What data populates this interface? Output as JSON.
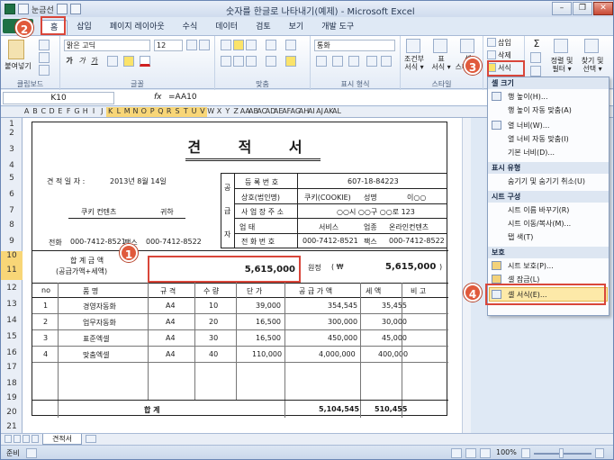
{
  "window": {
    "title": "숫자를 한글로 나타내기(예제) - Microsoft Excel",
    "qat_label": "눈금선"
  },
  "tabs": [
    "홈",
    "삽입",
    "페이지 레이아웃",
    "수식",
    "데이터",
    "검토",
    "보기",
    "개발 도구"
  ],
  "ribbon": {
    "clipboard": {
      "paste": "붙여넣기",
      "label": "클립보드"
    },
    "font": {
      "name": "맑은 고딕",
      "size": "12",
      "bold": "가",
      "italic": "가",
      "underline": "가",
      "label": "글꼴"
    },
    "alignment": {
      "label": "맞춤"
    },
    "number": {
      "format": "통화",
      "label": "표시 형식"
    },
    "style": {
      "cond": "조건부",
      "cond2": "서식 ▾",
      "table": "표",
      "table2": "서식 ▾",
      "cell": "셀",
      "cell2": "스타일 ▾",
      "label": "스타일"
    },
    "cells": {
      "insert": "삽입",
      "delete": "삭제",
      "format": "서식"
    },
    "editing": {
      "sort": "정렬 및",
      "sort2": "필터 ▾",
      "find": "찾기 및",
      "find2": "선택 ▾"
    }
  },
  "formula_bar": {
    "name_box": "K10",
    "fx": "fx",
    "content": "=AA10"
  },
  "columns": [
    "A",
    "B",
    "C",
    "D",
    "E",
    "F",
    "G",
    "H",
    "I",
    "J",
    "K",
    "L",
    "M",
    "N",
    "O",
    "P",
    "Q",
    "R",
    "S",
    "T",
    "U",
    "V",
    "W",
    "X",
    "Y",
    "Z",
    "AA",
    "AB",
    "AC",
    "AD",
    "AE",
    "AF",
    "AG",
    "AH",
    "AI",
    "AJ",
    "AK",
    "AL"
  ],
  "rows": [
    "1",
    "2",
    "3",
    "4",
    "5",
    "6",
    "7",
    "8",
    "9",
    "10",
    "11",
    "12",
    "13",
    "14",
    "15",
    "16",
    "17",
    "18",
    "19",
    "20",
    "21"
  ],
  "doc": {
    "title": "견 적 서",
    "date_label": "견 적 일 자 :",
    "date_value": "2013년 8월 14일",
    "client": "쿠키 컨텐츠",
    "honorific": "귀하",
    "phone_label": "전화",
    "phone": "000-7412-8521",
    "fax_label": "팩스",
    "fax": "000-7412-8522",
    "supplier_vertical": [
      "공",
      "급",
      "자"
    ],
    "supplier": {
      "reg_label": "등 록 번 호",
      "reg_value": "607-18-84223",
      "company_label": "상호(법인명)",
      "company_value": "쿠키(COOKIE)",
      "name_label": "성명",
      "name_value": "이○○",
      "addr_label": "사 업 장 주 소",
      "addr_value": "○○시 ○○구 ○○로 123",
      "biz_label": "업            태",
      "biz_value": "서비스",
      "type_label": "업종",
      "type_value": "온라인컨텐츠",
      "tel_label": "전 화 번 호",
      "tel_value": "000-7412-8521",
      "fax_label": "팩스",
      "fax_value": "000-7412-8522"
    },
    "total_label": "합 계 금 액",
    "total_sub": "(공급가액+세액)",
    "total_amount": "5,615,000",
    "won_label": "원정",
    "won_symbol": "(  ₩",
    "won_amount": "5,615,000",
    "won_close": ")",
    "headers": [
      "no",
      "품      명",
      "규  격",
      "수  량",
      "단  가",
      "공 급 가 액",
      "세  액",
      "비  고"
    ],
    "items": [
      [
        "1",
        "경영자동화",
        "A4",
        "10",
        "39,000",
        "354,545",
        "35,455",
        ""
      ],
      [
        "2",
        "업무자동화",
        "A4",
        "20",
        "16,500",
        "300,000",
        "30,000",
        ""
      ],
      [
        "3",
        "표준엑셀",
        "A4",
        "30",
        "16,500",
        "450,000",
        "45,000",
        ""
      ],
      [
        "4",
        "맞춤엑셀",
        "A4",
        "40",
        "110,000",
        "4,000,000",
        "400,000",
        ""
      ]
    ],
    "sum_label": "합        계",
    "sum_supply": "5,104,545",
    "sum_tax": "510,455"
  },
  "menu": {
    "size_head": "셀 크기",
    "row_height": "행 높이(H)...",
    "row_autofit": "행 높이 자동 맞춤(A)",
    "col_width": "열 너비(W)...",
    "col_autofit": "열 너비 자동 맞춤(I)",
    "default_width": "기본 너비(D)...",
    "vis_head": "표시 유형",
    "hide_unhide": "숨기기 및 숨기기 취소(U)",
    "org_head": "시트 구성",
    "rename": "시트 이름 바꾸기(R)",
    "move_copy": "시트 이동/복사(M)...",
    "tab_color": "탭 색(T)",
    "prot_head": "보호",
    "protect": "시트 보호(P)...",
    "lock": "셀 잠금(L)",
    "format_cells": "셀 서식(E)..."
  },
  "badges": [
    "1",
    "2",
    "3",
    "4"
  ],
  "sheet_tab": "견적서",
  "status": {
    "ready": "준비",
    "zoom": "100%"
  }
}
